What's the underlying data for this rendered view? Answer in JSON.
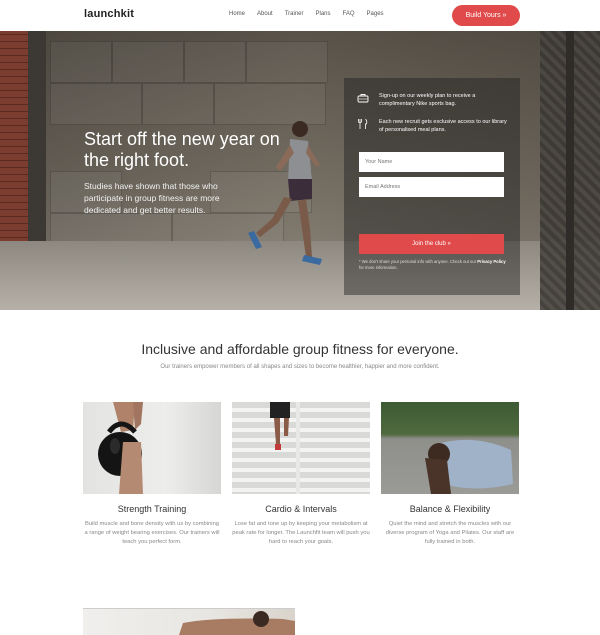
{
  "nav": {
    "logo": "launchkit",
    "items": [
      "Home",
      "About",
      "Trainer",
      "Plans",
      "FAQ",
      "Pages"
    ],
    "cta": "Build Yours »"
  },
  "hero": {
    "title": "Start off the new year on the right foot.",
    "text": "Studies have shown that those who participate in group fitness are more dedicated and get better results."
  },
  "signup": {
    "perk1": "Sign-up on our weekly plan to receive a complimentary Nike sports bag.",
    "perk2": "Each new recruit gets exclusive access to our library of personalised meal plans.",
    "name_placeholder": "Your Name",
    "email_placeholder": "Email Address",
    "button": "Join the club »",
    "fine_print": "* We don't share your personal info with anyone. Check out our",
    "fine_link": "Privacy Policy",
    "fine_end": "for more information."
  },
  "section": {
    "title": "Inclusive and affordable group fitness for everyone.",
    "subtitle": "Our trainers empower members of all shapes and sizes to become healthier, happier and more confident."
  },
  "cards": [
    {
      "title": "Strength Training",
      "text": "Build muscle and bone density with us by combining a range of weight bearing exercises. Our trainers will teach you perfect form."
    },
    {
      "title": "Cardio & Intervals",
      "text": "Lose fat and tone up by keeping your metabolism at peak rate for longer. The Launchfit team will push you hard to reach your goals."
    },
    {
      "title": "Balance & Flexibility",
      "text": "Quiet the mind and stretch the muscles with our diverse program of Yoga and Pilates. Our staff are fully trained in both."
    }
  ],
  "icons": {
    "bag": "bag-icon",
    "meal": "fork-knife-icon"
  },
  "colors": {
    "accent": "#e04a4a"
  }
}
